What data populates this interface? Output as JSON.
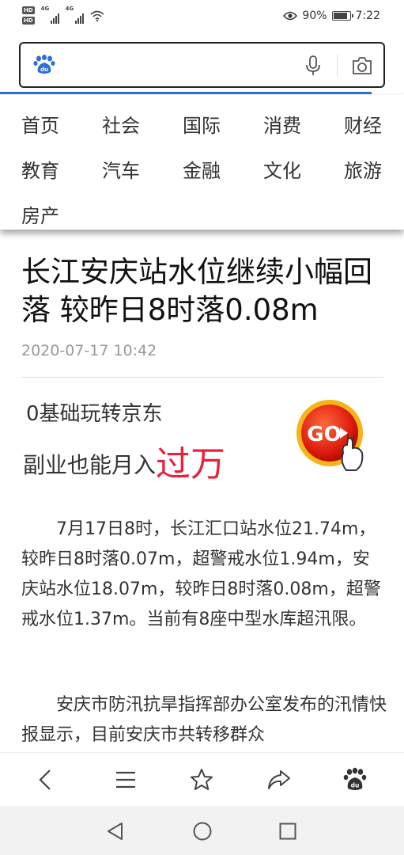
{
  "status_bar": {
    "hd1": "HD",
    "hd2": "HD",
    "net1": "4G",
    "net2": "4G",
    "battery_text": "90%",
    "battery_level": 0.9,
    "time": "7:22"
  },
  "search": {
    "placeholder": ""
  },
  "nav": {
    "items": [
      "首页",
      "社会",
      "国际",
      "消费",
      "财经",
      "教育",
      "汽车",
      "金融",
      "文化",
      "旅游",
      "房产"
    ]
  },
  "article": {
    "title": "长江安庆站水位继续小幅回落 较昨日8时落0.08m",
    "date": "2020-07-17 10:42",
    "ad": {
      "line1": "0基础玩转京东",
      "line2_prefix": "副业也能月入",
      "line2_highlight": "过万",
      "button": "GO"
    },
    "paragraphs": [
      "7月17日8时，长江汇口站水位21.74m，较昨日8时落0.07m，超警戒水位1.94m，安庆站水位18.07m，较昨日8时落0.08m，超警戒水位1.37m。当前有8座中型水库超汛限。",
      "安庆市防汛抗旱指挥部办公室发布的汛情快报显示，目前安庆市共转移群众"
    ]
  },
  "colors": {
    "accent_blue": "#2e6fd9",
    "ad_red": "#e8203a",
    "baidu_blue": "#2e6fd9"
  }
}
